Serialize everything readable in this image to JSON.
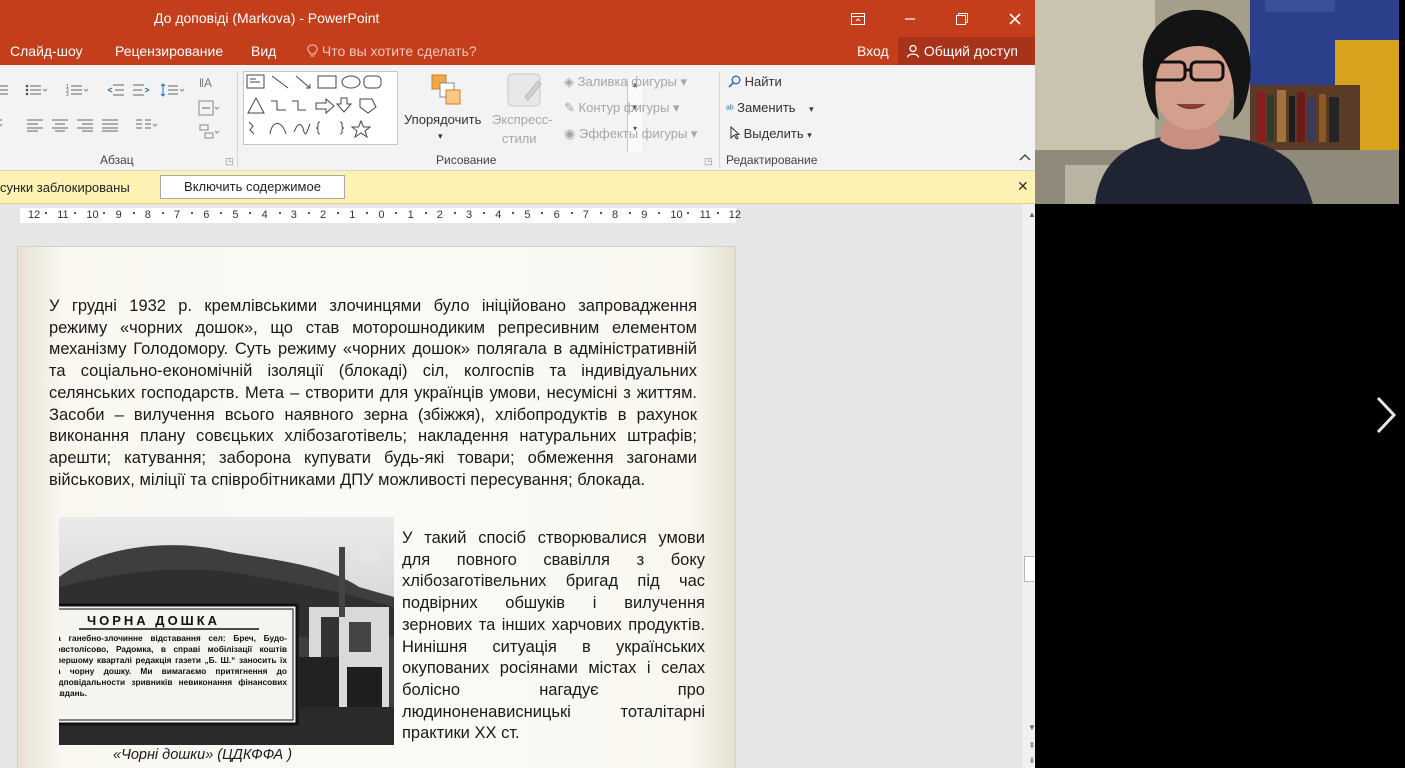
{
  "window": {
    "title": "До доповіді (Markova) - PowerPoint"
  },
  "menu": {
    "items": [
      "Слайд-шоу",
      "Рецензирование",
      "Вид"
    ],
    "tell_me": "Что вы хотите сделать?",
    "signin": "Вход",
    "share": "Общий доступ"
  },
  "ribbon": {
    "paragraph_label": "Абзац",
    "drawing_label": "Рисование",
    "editing_label": "Редактирование",
    "arrange": "Упорядочить",
    "quick_styles_1": "Экспресс-",
    "quick_styles_2": "стили",
    "shape_fill": "Заливка фигуры",
    "shape_outline": "Контур фигуры",
    "shape_effects": "Эффекты фигуры",
    "find": "Найти",
    "replace": "Заменить",
    "select": "Выделить"
  },
  "message_bar": {
    "text": "сунки заблокированы",
    "button": "Включить содержимое"
  },
  "ruler": {
    "ticks": [
      "12",
      "11",
      "10",
      "9",
      "8",
      "7",
      "6",
      "5",
      "4",
      "3",
      "2",
      "1",
      "0",
      "1",
      "2",
      "3",
      "4",
      "5",
      "6",
      "7",
      "8",
      "9",
      "10",
      "11",
      "12"
    ]
  },
  "slide": {
    "paragraph1": "У грудні 1932 р. кремлівськими злочинцями було ініційовано запровадження режиму «чорних дошок», що став моторошнодиким репресивним елементом механізму Голодомору. Суть режиму «чорних дошок» полягала в адміністративній та соціально-економічній ізоляції (блокаді) сіл, колгоспів та індивідуальних селянських господарств. Мета – створити для українців умови, несумісні з життям. Засоби – вилучення всього наявного зерна (збіжжя), хлібопродуктів в рахунок виконання плану совєцьких хлібозаготівель; накладення натуральних штрафів; арешти; катування; заборона купувати будь-які товари; обмеження загонами військових, міліції та співробітниками ДПУ можливості пересування; блокада.",
    "paragraph2": "У такий спосіб створювалися умови для повного свавілля з боку хлібозаготівельних бригад під час подвірних обшуків і вилучення зернових та інших харчових продуктів. Нинішня ситуація в українських окупованих росіянами містах і селах болісно нагадує про людиноненависницькі тоталітарні практики ХХ ст.",
    "photo_board_title": "ЧОРНА ДОШКА",
    "photo_board_text": "За ганебно-злочинне відставання сел: Бреч, Будо-Товстолісово, Радомка, в справі мобілізації коштів впершому кварталі редакція газети „Б. Ш.“ заносить їх на чорну дошку. Ми вимагаємо притягнення до відповідальности зривників невиконання фінансових завдань.",
    "caption": "«Чорні дошки» (ЦДКФФА )"
  },
  "colors": {
    "accent": "#c43e1c",
    "message_bar": "#fdf1b3"
  }
}
